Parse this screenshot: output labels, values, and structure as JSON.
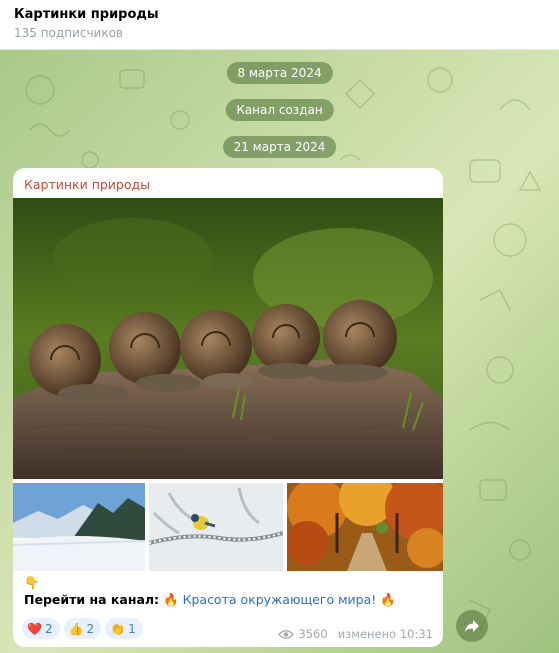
{
  "header": {
    "title": "Картинки природы",
    "subtitle": "135 подписчиков"
  },
  "service_messages": {
    "date1": "8 марта 2024",
    "channel_created": "Канал создан",
    "date2": "21 марта 2024"
  },
  "post": {
    "channel_name": "Картинки природы",
    "emoji_pointer": "👇",
    "text_bold": "Перейти на канал:",
    "fire_emoji": "🔥",
    "link_text": "Красота окружающего мира!",
    "reactions": [
      {
        "emoji": "❤️",
        "count": "2"
      },
      {
        "emoji": "👍",
        "count": "2"
      },
      {
        "emoji": "👏",
        "count": "1"
      }
    ],
    "views": "3560",
    "edited_time": "изменено 10:31"
  },
  "icons": {
    "views": "eye-icon",
    "forward": "share-arrow-icon"
  },
  "colors": {
    "channel_name": "#c44a3a",
    "link": "#2a74c0",
    "reaction_bg": "#e8f0fb",
    "service_pill": "#4d7037"
  }
}
